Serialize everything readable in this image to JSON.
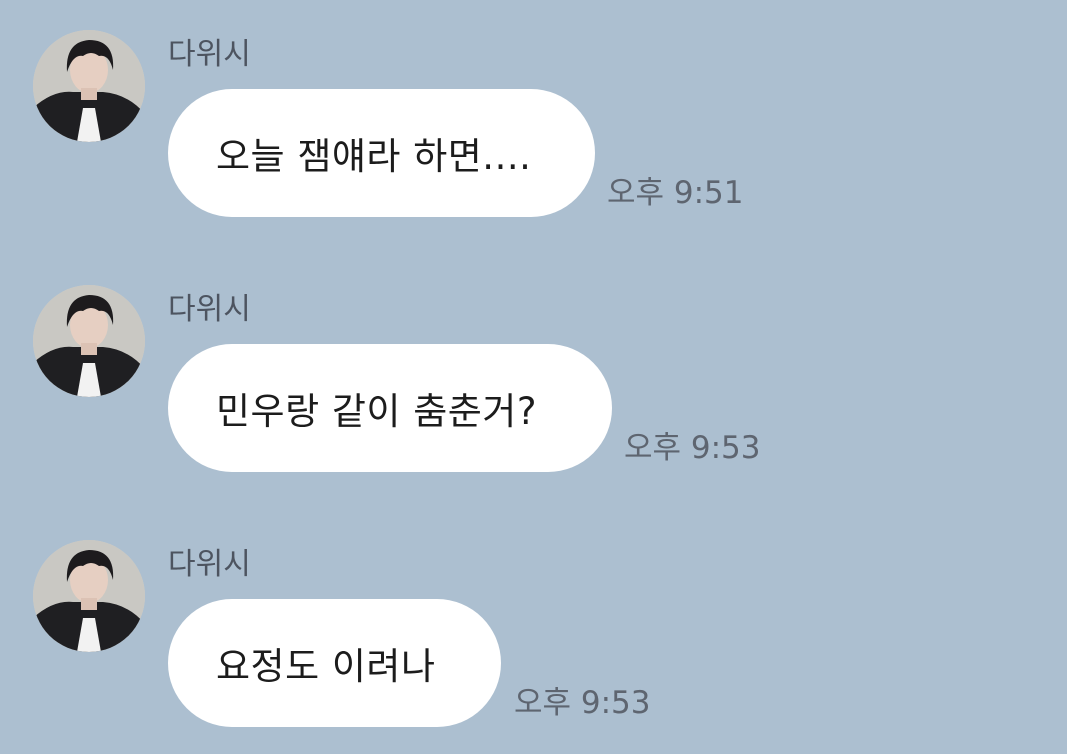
{
  "chat": {
    "messages": [
      {
        "sender": "다위시",
        "text": "오늘 잼얘라 하면....",
        "time": "오후 9:51"
      },
      {
        "sender": "다위시",
        "text": "민우랑 같이 춤춘거?",
        "time": "오후 9:53"
      },
      {
        "sender": "다위시",
        "text": "요정도 이려나",
        "time": "오후 9:53"
      }
    ]
  },
  "colors": {
    "background": "#acbfd0",
    "bubble": "#ffffff",
    "sender_text": "#4d5460",
    "time_text": "#5e6570"
  }
}
